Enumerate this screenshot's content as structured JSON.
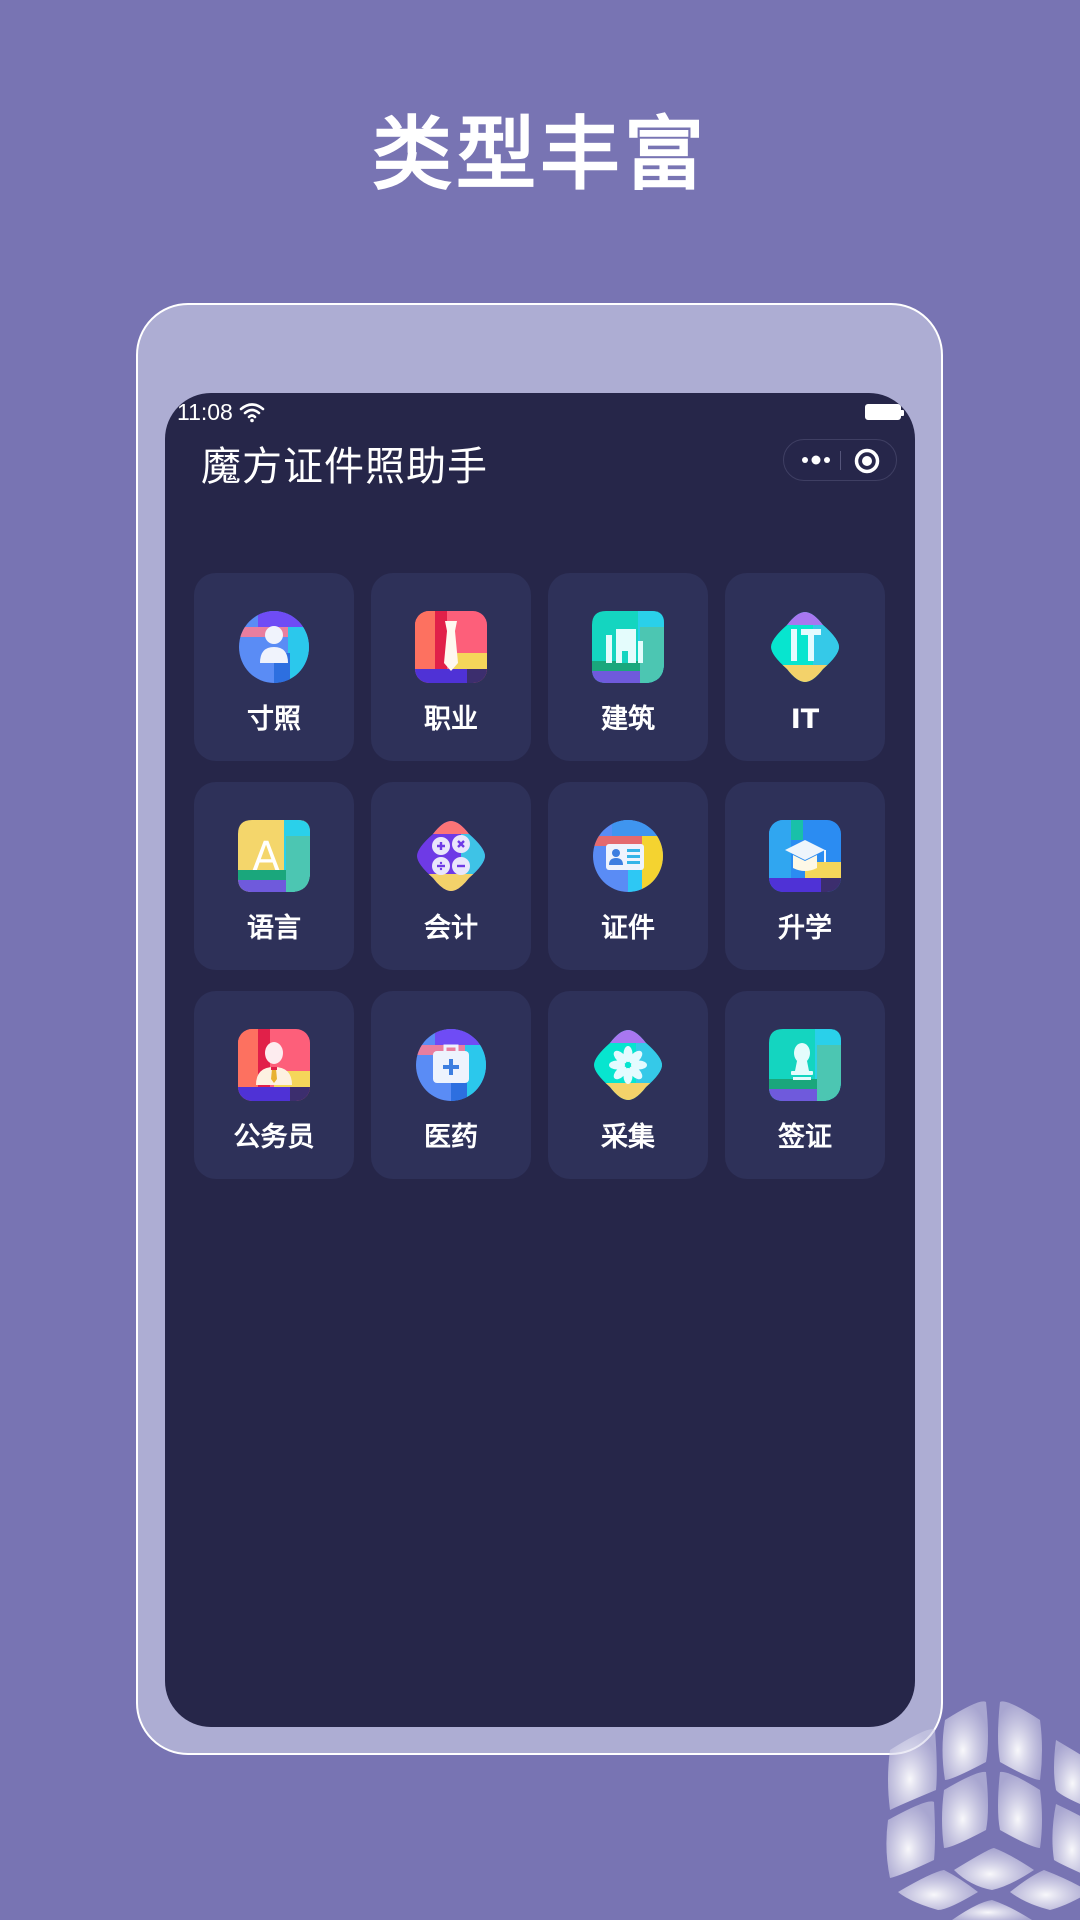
{
  "headline": "类型丰富",
  "status_bar": {
    "time": "11:08",
    "wifi_icon": "wifi-icon",
    "battery_icon": "battery-icon"
  },
  "navbar": {
    "title": "魔方证件照助手",
    "more_icon": "more-dots-icon",
    "close_icon": "target-close-icon"
  },
  "categories": [
    {
      "label": "寸照",
      "icon": "person-portrait-icon"
    },
    {
      "label": "职业",
      "icon": "necktie-icon"
    },
    {
      "label": "建筑",
      "icon": "building-icon"
    },
    {
      "label": "IT",
      "icon": "it-icon"
    },
    {
      "label": "语言",
      "icon": "letter-a-icon"
    },
    {
      "label": "会计",
      "icon": "calculator-icon"
    },
    {
      "label": "证件",
      "icon": "id-card-icon"
    },
    {
      "label": "升学",
      "icon": "graduation-cap-icon"
    },
    {
      "label": "公务员",
      "icon": "civil-servant-icon"
    },
    {
      "label": "医药",
      "icon": "medical-bag-icon"
    },
    {
      "label": "采集",
      "icon": "flower-icon"
    },
    {
      "label": "签证",
      "icon": "stamp-icon"
    }
  ],
  "colors": {
    "background": "#7874b3",
    "frame": "#adadd3",
    "screen": "#262649",
    "card": "#2e3159"
  }
}
